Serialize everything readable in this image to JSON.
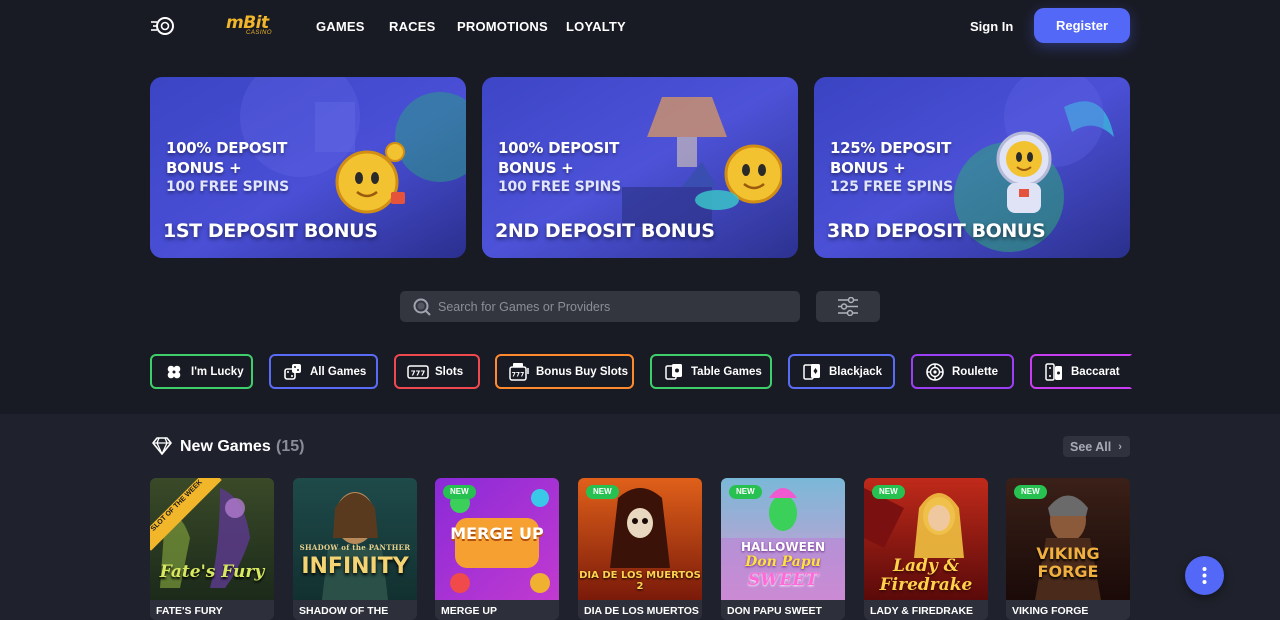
{
  "header": {
    "logo_text": "mBit",
    "logo_sub": "CASINO",
    "nav": [
      "GAMES",
      "RACES",
      "PROMOTIONS",
      "LOYALTY"
    ],
    "signin": "Sign In",
    "register": "Register"
  },
  "promos": [
    {
      "line1": "100% DEPOSIT",
      "line2": "BONUS +",
      "line3": "100 FREE SPINS",
      "title": "1ST DEPOSIT BONUS"
    },
    {
      "line1": "100% DEPOSIT",
      "line2": "BONUS +",
      "line3": "100 FREE SPINS",
      "title": "2ND DEPOSIT BONUS"
    },
    {
      "line1": "125% DEPOSIT",
      "line2": "BONUS +",
      "line3": "125 FREE SPINS",
      "title": "3RD DEPOSIT BONUS"
    }
  ],
  "search": {
    "placeholder": "Search for Games or Providers"
  },
  "categories": [
    {
      "label": "I'm Lucky",
      "icon": "clover-icon",
      "color": "#3ecf6a"
    },
    {
      "label": "All Games",
      "icon": "dice-icon",
      "color": "#5a6cf5"
    },
    {
      "label": "Slots",
      "icon": "slot-777-icon",
      "color": "#f0484f"
    },
    {
      "label": "Bonus Buy Slots",
      "icon": "slot-machine-icon",
      "color": "#ff8a2d"
    },
    {
      "label": "Table Games",
      "icon": "table-games-icon",
      "color": "#3ecf6a"
    },
    {
      "label": "Blackjack",
      "icon": "cards-icon",
      "color": "#5a6cf5"
    },
    {
      "label": "Roulette",
      "icon": "roulette-icon",
      "color": "#9b3ff5"
    },
    {
      "label": "Baccarat",
      "icon": "baccarat-icon",
      "color": "#c93df2"
    }
  ],
  "new_games": {
    "title": "New Games",
    "count": "(15)",
    "see_all": "See All",
    "ribbon_text": "SLOT OF THE WEEK",
    "badge": "NEW",
    "games": [
      {
        "name": "FATE'S FURY",
        "art": "Fate's Fury",
        "new": false
      },
      {
        "name": "SHADOW OF THE",
        "art": "INFINITY",
        "art_sub": "SHADOW of the PANTHER",
        "new": false
      },
      {
        "name": "MERGE UP",
        "art": "MERGE UP",
        "new": true
      },
      {
        "name": "DIA DE LOS MUERTOS",
        "art": "DIA DE LOS MUERTOS 2",
        "new": true
      },
      {
        "name": "DON PAPU SWEET",
        "art": "HALLOWEEN",
        "art_sub": "Don Papu",
        "art_sub2": "SWEET",
        "new": true
      },
      {
        "name": "LADY & FIREDRAKE",
        "art": "Lady &",
        "art_sub": "Firedrake",
        "new": true
      },
      {
        "name": "VIKING FORGE",
        "art": "VIKING",
        "art_sub": "FORGE",
        "new": true
      }
    ]
  },
  "colors": {
    "accent": "#5468f7",
    "background": "#191b24",
    "logo": "#f2b62b",
    "new_badge": "#27c152"
  }
}
